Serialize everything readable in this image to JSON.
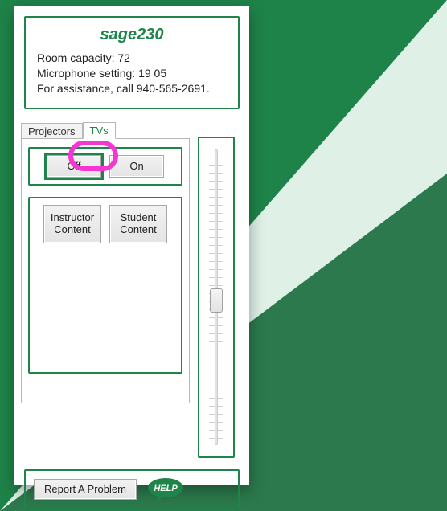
{
  "header": {
    "title": "sage230",
    "capacity_line": "Room capacity: 72",
    "mic_line": "Microphone setting: 19 05",
    "assist_line": "For assistance, call 940-565-2691."
  },
  "tabs": {
    "projectors": "Projectors",
    "tvs": "TVs",
    "active": "TVs"
  },
  "controls": {
    "off": "Off",
    "on": "On",
    "instructor": "Instructor Content",
    "student": "Student Content"
  },
  "footer": {
    "report": "Report A Problem",
    "help": "HELP"
  },
  "slider": {
    "value_percent": 47
  },
  "colors": {
    "accent": "#1e8449",
    "highlight": "#f536d3"
  }
}
